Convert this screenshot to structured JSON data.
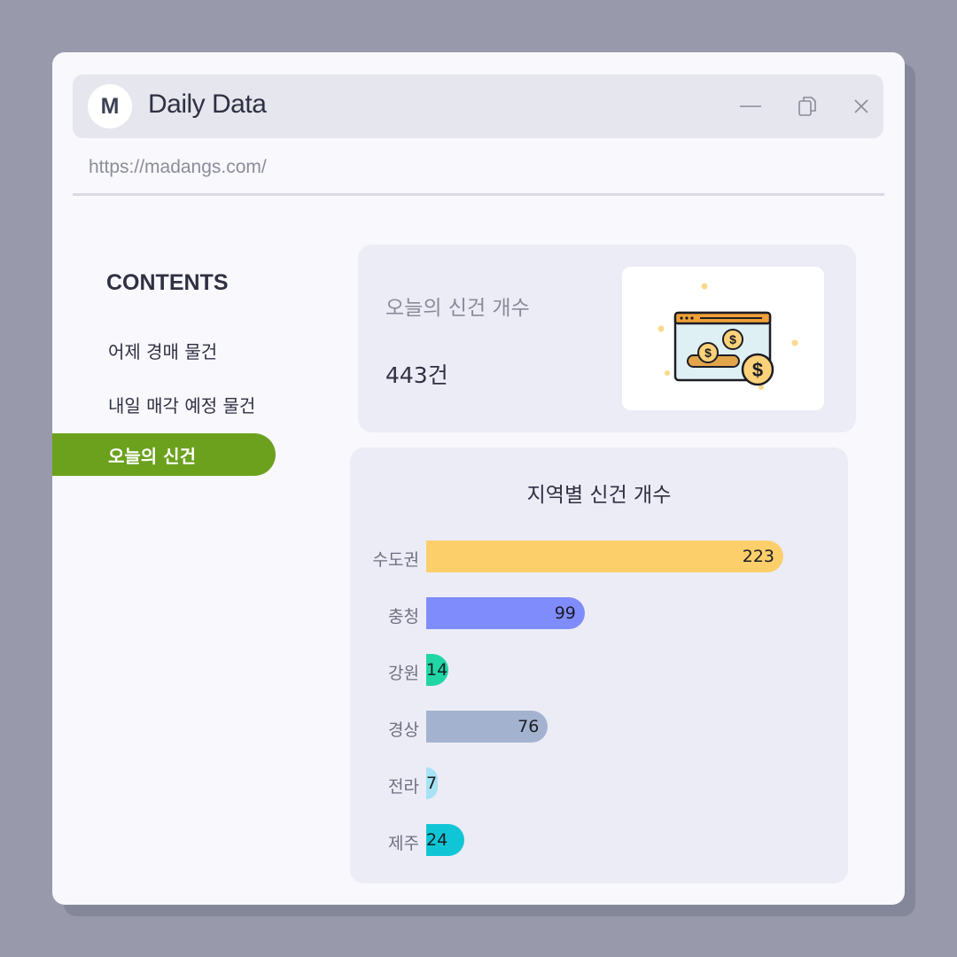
{
  "window": {
    "avatar_letter": "M",
    "title": "Daily Data",
    "url": "https://madangs.com/"
  },
  "sidebar": {
    "heading": "CONTENTS",
    "items": [
      {
        "label": "어제 경매 물건",
        "active": false
      },
      {
        "label": "내일 매각 예정 물건",
        "active": false
      },
      {
        "label": "오늘의 신건",
        "active": true
      }
    ]
  },
  "summary": {
    "label": "오늘의 신건 개수",
    "value": "443건",
    "illustration_icon": "money-browser-icon"
  },
  "colors": {
    "accent": "#6ca11e"
  },
  "chart_data": {
    "type": "bar",
    "title": "지역별 신건 개수",
    "orientation": "horizontal",
    "categories": [
      "수도권",
      "충청",
      "강원",
      "경상",
      "전라",
      "제주"
    ],
    "values": [
      223,
      99,
      14,
      76,
      7,
      24
    ],
    "colors": [
      "#fccf6b",
      "#7f8cfc",
      "#21d6a5",
      "#a3b3cf",
      "#a7e3f4",
      "#10c6d6"
    ],
    "xlim": [
      0,
      223
    ]
  }
}
